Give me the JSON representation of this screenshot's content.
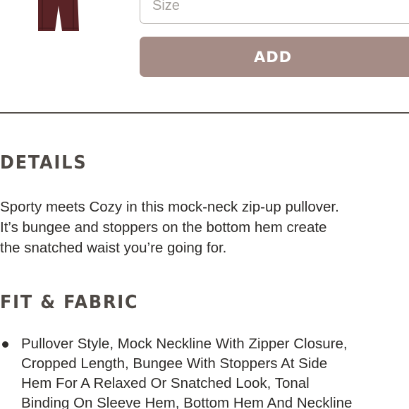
{
  "product": {
    "thumbnail_icon": "pants-thumbnail",
    "thumbnail_color": "#5a2326"
  },
  "size_select": {
    "placeholder": "Size"
  },
  "add_button": {
    "label": "ADD",
    "color": "#a58c86"
  },
  "details": {
    "heading": "DETAILS",
    "lines": [
      "Sporty meets Cozy in this mock-neck zip-up pullover.",
      "It’s bungee and stoppers on the bottom hem create",
      "the snatched waist you’re going for."
    ]
  },
  "fit_fabric": {
    "heading": "FIT & FABRIC",
    "items": [
      {
        "lines": [
          "Pullover Style, Mock Neckline With Zipper Closure,",
          "Cropped Length, Bungee With Stoppers At Side",
          "Hem For A Relaxed Or Snatched Look, Tonal",
          "Binding On Sleeve Hem, Bottom Hem And Neckline"
        ]
      }
    ]
  }
}
